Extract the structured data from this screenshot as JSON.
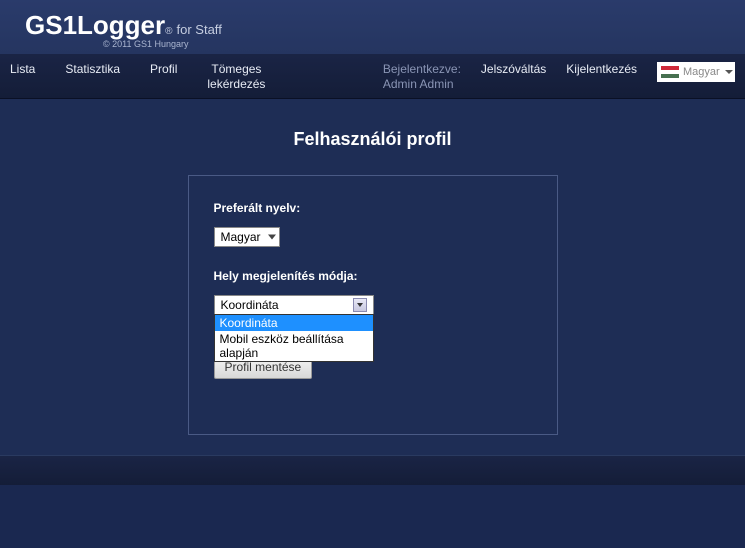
{
  "header": {
    "logo_main": "GS1Logger",
    "logo_sub": "for Staff",
    "logo_reg": "®",
    "copyright": "© 2011 GS1 Hungary"
  },
  "nav": {
    "items": [
      "Lista",
      "Statisztika",
      "Profil",
      "Tömeges\nlekérdezés"
    ],
    "login_label": "Bejelentkezve:",
    "login_user": "Admin Admin",
    "pwchange": "Jelszóváltás",
    "logout": "Kijelentkezés",
    "lang_selected": "Magyar"
  },
  "page": {
    "title": "Felhasználói profil",
    "pref_lang_label": "Preferált nyelv:",
    "pref_lang_value": "Magyar",
    "loc_mode_label": "Hely megjelenítés módja:",
    "loc_mode_value": "Koordináta",
    "loc_mode_options": [
      "Koordináta",
      "Mobil eszköz beállítása alapján"
    ],
    "save_button": "Profil mentése"
  }
}
